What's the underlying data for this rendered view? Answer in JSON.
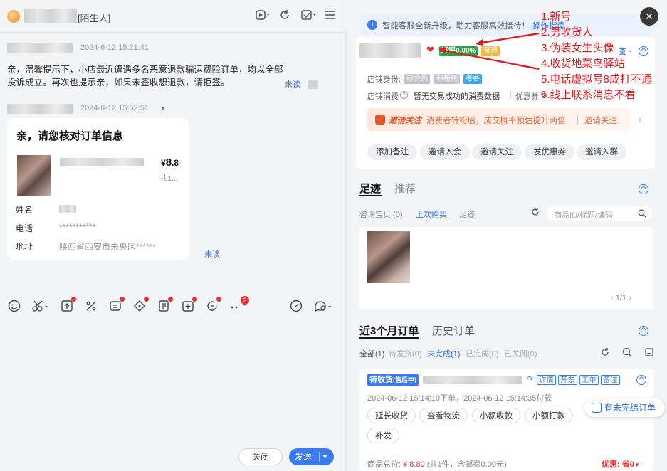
{
  "chat_header": {
    "tag": "[陌生人]"
  },
  "messages": [
    {
      "time": "2024-6-12 15:21:41",
      "text": "亲，温馨提示下，小店最近遭遇多名恶意退款骗运费险订单，均以全部投诉成立。再次也提示亲，如果未签收想退款，请拒签。",
      "status": "未读"
    },
    {
      "time": "2024-6-12 15:52:51"
    }
  ],
  "order_card": {
    "title": "亲，请您核对订单信息",
    "price_prefix": "¥",
    "price_int": "8",
    "price_dec": ".8",
    "qty": "共1...",
    "name_label": "姓名",
    "phone_label": "电话",
    "phone_value": "***********",
    "addr_label": "地址",
    "addr_value": "陕西省西安市未央区******",
    "status": "未读"
  },
  "toolbar": {
    "badge_count": "2"
  },
  "footer": {
    "close_label": "关闭",
    "send_label": "发送"
  },
  "notice": {
    "text": "智能客服全新升级，助力客服高效接待！",
    "link": "操作指南"
  },
  "customer": {
    "good_rate": "好评0.00%",
    "level": "普通",
    "view_more": "查",
    "identity_label": "店铺身份:",
    "identity_tags": [
      "非会员",
      "非粉丝",
      "老客"
    ],
    "spend_label": "店铺消费",
    "spend_value": "暂无交易成功的消费数据",
    "coupon_label": "优惠券",
    "coupon_value": "0"
  },
  "banner": {
    "title": "邀请关注",
    "text": "消费者转粉后，成交概率预估提升两倍",
    "action": "邀请关注"
  },
  "actions": [
    "添加备注",
    "邀请入会",
    "邀请关注",
    "发优惠券",
    "邀请入群"
  ],
  "footprint": {
    "tab_active": "足迹",
    "tab_other": "推荐",
    "sub": [
      "咨询宝贝 (0)",
      "上次购买",
      "足迹"
    ],
    "search_placeholder": "商品ID/标题/编码",
    "pager": "1/1"
  },
  "orders": {
    "tab_active": "近3个月订单",
    "tab_other": "历史订单",
    "filters": [
      "全部(1)",
      "待发货(0)",
      "未完成(1)",
      "已完成(0)",
      "已关闭(0)"
    ],
    "status": "待收货",
    "status_sub": "(售后中)",
    "links": [
      "详情",
      "开票",
      "工单",
      "备注"
    ],
    "time": "2024-06-12 15:14:19下单，2024-06-12 15:14:35付款",
    "buttons": [
      "延长收货",
      "查看物流",
      "小额收款",
      "小额打款",
      "补发"
    ],
    "unfinished": "有未完结订单",
    "total_label": "商品总价:",
    "total_value": "¥ 8.80",
    "total_detail": "(共1件，含邮费0.00元)",
    "discount": "优惠: 省0"
  },
  "annotations": [
    "1.新号",
    "2.男收货人",
    "3.伪装女生头像",
    "4.收货地菜鸟驿站",
    "5.电话虚拟号8成打不通",
    "6.线上联系消息不看"
  ],
  "colors": {
    "accent": "#3a7cf0",
    "annotation": "#e4161b",
    "good": "#25a744"
  }
}
